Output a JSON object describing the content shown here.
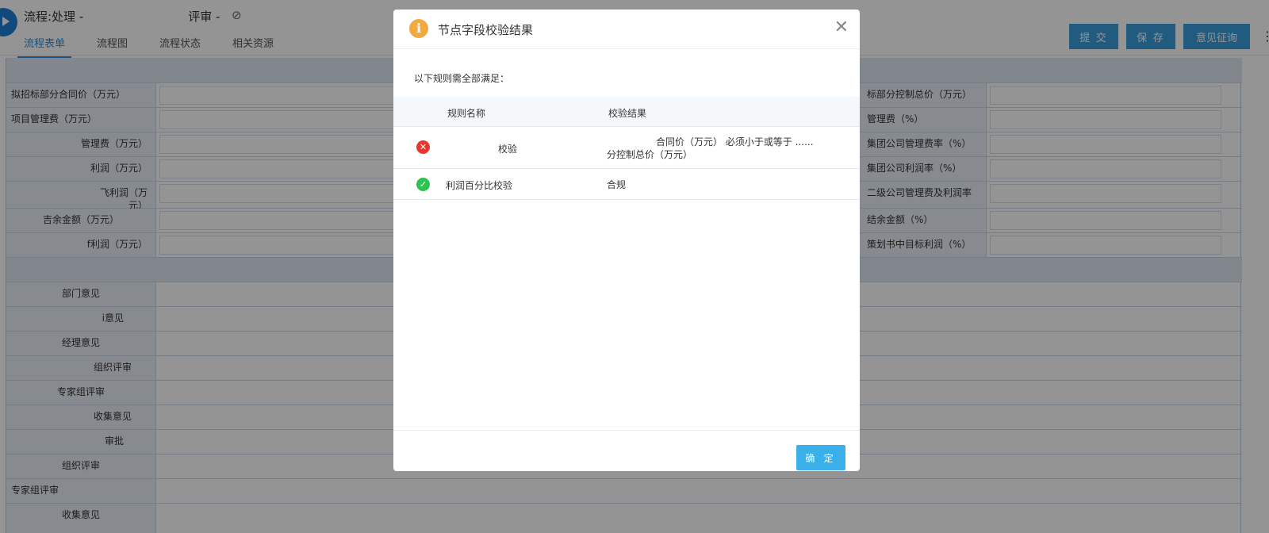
{
  "header": {
    "title_prefix": "流程:处理 -",
    "title_suffix": "评审 -",
    "tabs": [
      "流程表单",
      "流程图",
      "流程状态",
      "相关资源"
    ],
    "buttons": {
      "submit": "提 交",
      "save": "保 存",
      "consult": "意见征询"
    }
  },
  "form": {
    "left_labels": [
      "拟招标部分合同价（万元）",
      "项目管理费（万元）",
      "管理费（万元）",
      "利润（万元）",
      "飞利润（万\n元）",
      "吉余金额（万元）",
      "f利润（万元）"
    ],
    "right_labels": [
      "标部分控制总价（万元）",
      "管理费（%）",
      "集团公司管理费率（%）",
      "集团公司利润率（%）",
      "二级公司管理费及利润率",
      "结余金额（%）",
      "策划书中目标利润（%）"
    ],
    "opinion_labels": [
      "部门意见",
      "i意见",
      "经理意见",
      "组织评审",
      "专家组评审",
      "收集意见",
      "审批",
      "组织评审",
      "专家组评审",
      "收集意见"
    ]
  },
  "dialog": {
    "title": "节点字段校验结果",
    "description": "以下规则需全部满足：",
    "columns": {
      "name": "规则名称",
      "result": "校验结果"
    },
    "rules": [
      {
        "name": "校验",
        "result_line1": "合同价（万元） 必须小于或等于 ......",
        "result_line2": "分控制总价（万元）",
        "status": "fail"
      },
      {
        "name": "利润百分比校验",
        "result_line1": "合规",
        "result_line2": "",
        "status": "pass"
      }
    ],
    "confirm": "确 定"
  }
}
